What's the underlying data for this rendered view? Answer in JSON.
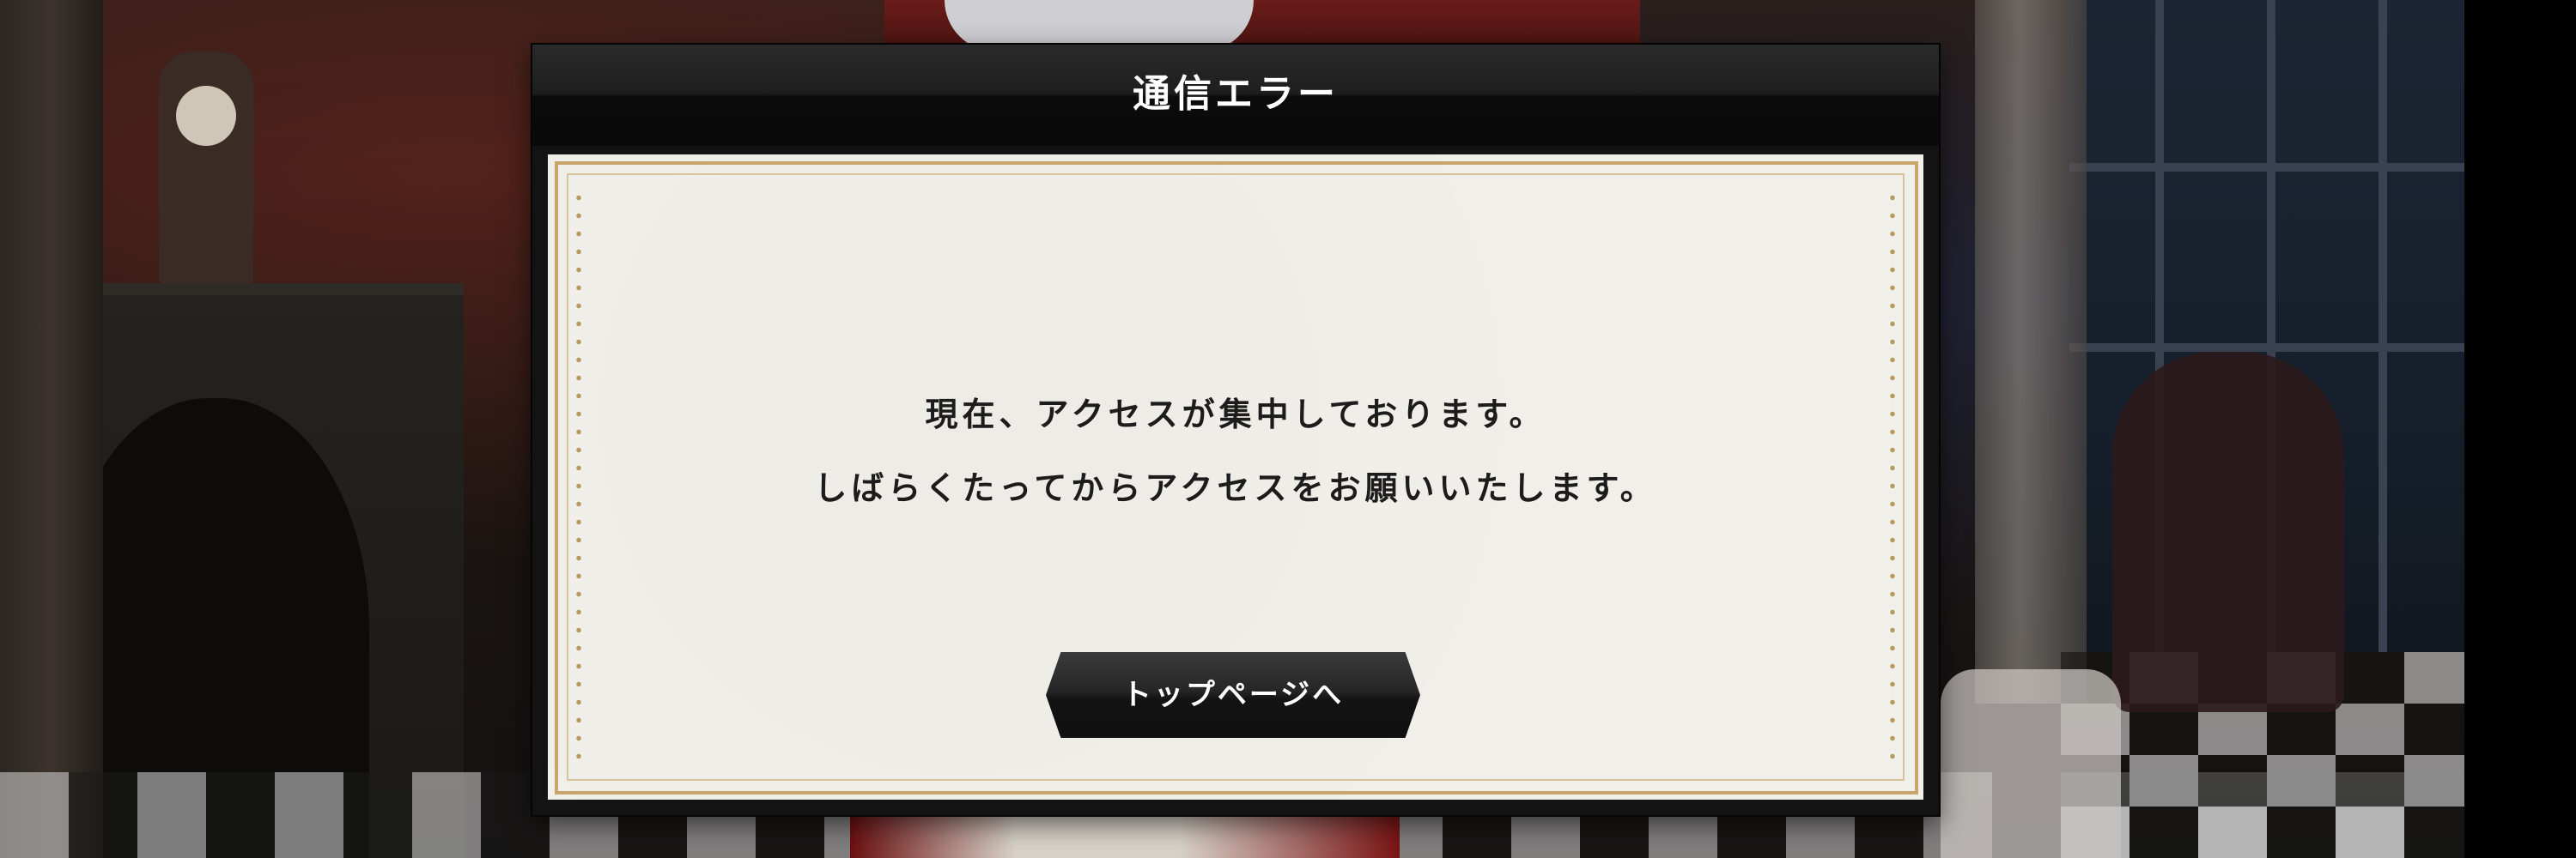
{
  "dialog": {
    "title": "通信エラー",
    "message_lines": [
      "現在、アクセスが集中しております。",
      "しばらくたってからアクセスをお願いいたします。"
    ],
    "button_label": "トップページへ"
  },
  "colors": {
    "header_bg": "#1a1a1a",
    "body_bg": "#f1efe9",
    "frame_gold": "#c7a56c",
    "button_bg": "#1e1e1e",
    "text_dark": "#1c1c1c",
    "text_light": "#ffffff"
  }
}
